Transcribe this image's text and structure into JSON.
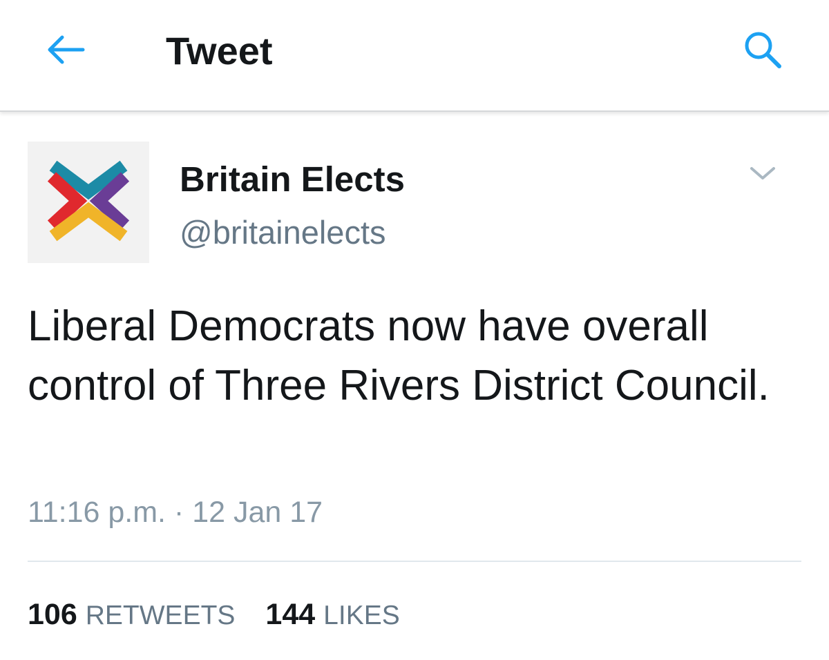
{
  "header": {
    "back_icon": "arrow-left-icon",
    "title": "Tweet",
    "search_icon": "search-icon",
    "accent_color": "#1da1f2"
  },
  "tweet": {
    "author": {
      "display_name": "Britain Elects",
      "handle": "@britainelects",
      "avatar_icon": "britain-elects-logo"
    },
    "menu_icon": "chevron-down-icon",
    "text": "Liberal Democrats now have overall control of Three Rivers District Council.",
    "timestamp": "11:16 p.m. · 12 Jan 17",
    "stats": {
      "retweets_count": "106",
      "retweets_label": "RETWEETS",
      "likes_count": "144",
      "likes_label": "LIKES"
    }
  },
  "colors": {
    "logo_teal": "#1c8ba6",
    "logo_red": "#e0292e",
    "logo_purple": "#6a3d96",
    "logo_yellow": "#f0b429",
    "secondary_text": "#657786"
  }
}
